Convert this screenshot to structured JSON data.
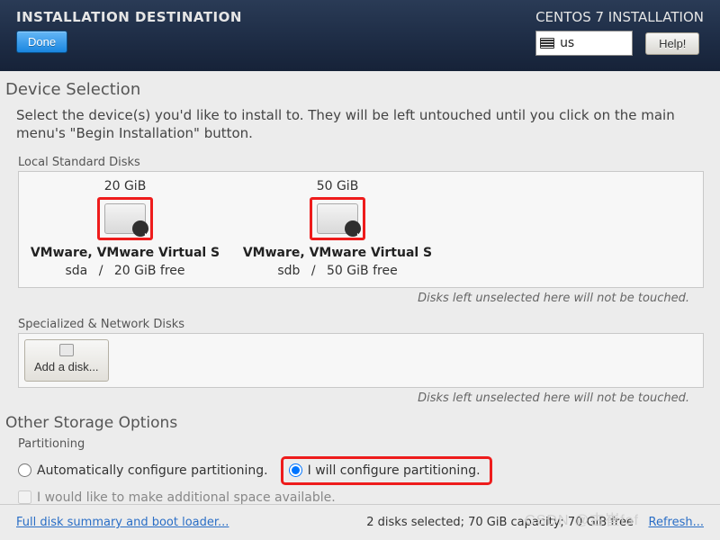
{
  "header": {
    "title": "INSTALLATION DESTINATION",
    "distro": "CENTOS 7 INSTALLATION",
    "done_label": "Done",
    "keyboard_layout": "us",
    "help_label": "Help!"
  },
  "device_selection": {
    "heading": "Device Selection",
    "intro": "Select the device(s) you'd like to install to.  They will be left untouched until you click on the main menu's \"Begin Installation\" button.",
    "local_heading": "Local Standard Disks",
    "disks": [
      {
        "capacity": "20 GiB",
        "model": "VMware, VMware Virtual S",
        "dev": "sda",
        "free": "20 GiB free",
        "selected": true
      },
      {
        "capacity": "50 GiB",
        "model": "VMware, VMware Virtual S",
        "dev": "sdb",
        "free": "50 GiB free",
        "selected": true
      }
    ],
    "untouched_note": "Disks left unselected here will not be touched.",
    "network_heading": "Specialized & Network Disks",
    "add_disk_label": "Add a disk..."
  },
  "storage_options": {
    "heading": "Other Storage Options",
    "partitioning_label": "Partitioning",
    "auto_label": "Automatically configure partitioning.",
    "manual_label": "I will configure partitioning.",
    "selected": "manual",
    "make_space_label": "I would like to make additional space available."
  },
  "footer": {
    "summary_link": "Full disk summary and boot loader...",
    "status": "2 disks selected; 70 GiB capacity; 70 GiB free",
    "refresh_link": "Refresh..."
  },
  "watermark": "CSDN @古崔fof"
}
